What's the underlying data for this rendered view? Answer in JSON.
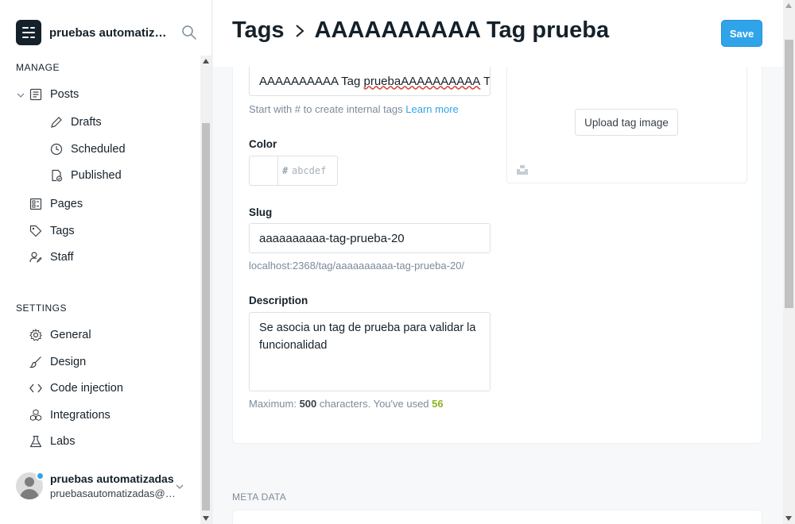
{
  "app": {
    "site_title": "pruebas automatizadas",
    "accent": "#30a4e9"
  },
  "sidebar": {
    "manage_title": "MANAGE",
    "settings_title": "SETTINGS",
    "manage_items": [
      {
        "label": "Posts",
        "icon": "posts-icon"
      },
      {
        "label": "Drafts",
        "icon": "pencil-icon"
      },
      {
        "label": "Scheduled",
        "icon": "clock-icon"
      },
      {
        "label": "Published",
        "icon": "published-icon"
      },
      {
        "label": "Pages",
        "icon": "pages-icon"
      },
      {
        "label": "Tags",
        "icon": "tag-icon"
      },
      {
        "label": "Staff",
        "icon": "staff-icon"
      }
    ],
    "settings_items": [
      {
        "label": "General",
        "icon": "gear-icon"
      },
      {
        "label": "Design",
        "icon": "brush-icon"
      },
      {
        "label": "Code injection",
        "icon": "code-icon"
      },
      {
        "label": "Integrations",
        "icon": "integrations-icon"
      },
      {
        "label": "Labs",
        "icon": "flask-icon"
      }
    ],
    "user": {
      "name": "pruebas automatizadas",
      "email": "pruebasautomatizadas@uniandes.edu.co"
    }
  },
  "header": {
    "crumb_root": "Tags",
    "crumb_current": "AAAAAAAAAA Tag prueba",
    "save_label": "Save"
  },
  "form": {
    "name_value_plain": "AAAAAAAAAA Tag ",
    "name_value_marked": "pruebaAAAAAAAAAA",
    "name_value_tail": " T",
    "name_hint": "Start with # to create internal tags",
    "name_hint_link": "Learn more",
    "color_label": "Color",
    "color_hash": "#",
    "color_placeholder": "abcdef",
    "slug_label": "Slug",
    "slug_value": "aaaaaaaaaa-tag-prueba-20",
    "slug_url": "localhost:2368/tag/aaaaaaaaaa-tag-prueba-20/",
    "description_label": "Description",
    "description_value": "Se asocia un tag de prueba para validar la funcionalidad",
    "desc_hint_prefix": "Maximum:",
    "desc_max": "500",
    "desc_hint_mid": "characters. You've used",
    "desc_used": "56",
    "upload_label": "Upload tag image"
  },
  "meta": {
    "title": "META DATA"
  }
}
